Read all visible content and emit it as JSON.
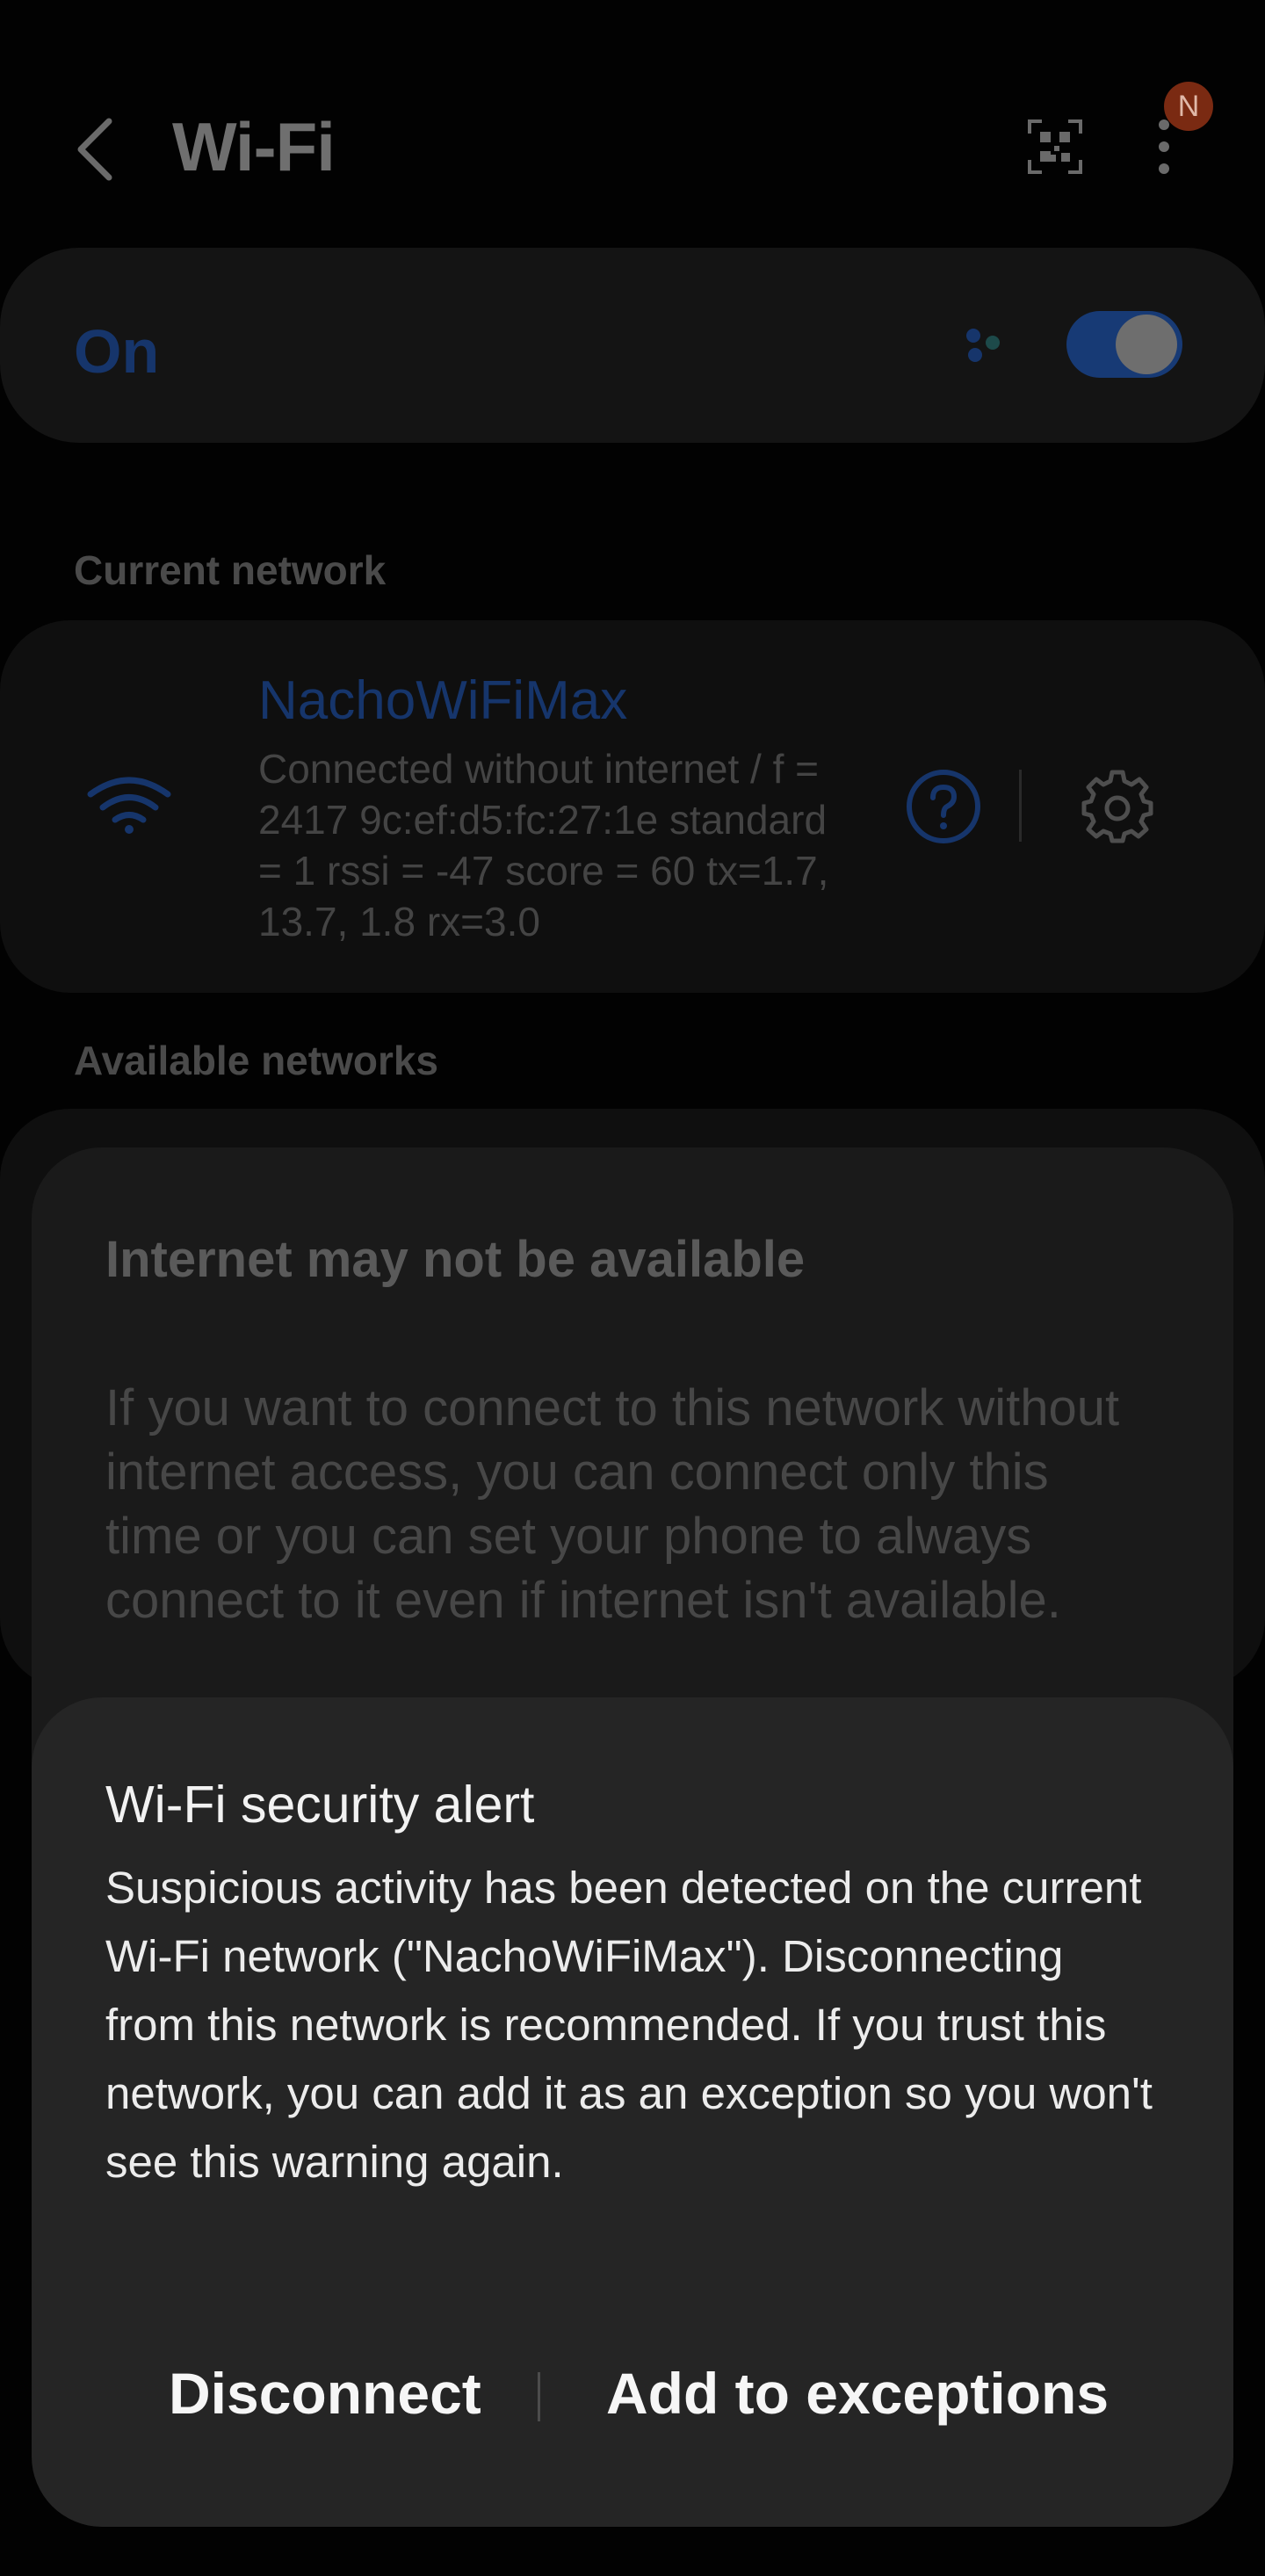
{
  "header": {
    "title": "Wi-Fi",
    "avatar_letter": "N",
    "icons": [
      "back-icon",
      "qr-code-icon",
      "more-options-icon"
    ]
  },
  "wifi_toggle": {
    "label": "On",
    "state": "on"
  },
  "current_network": {
    "section_title": "Current network",
    "name": "NachoWiFiMax",
    "details": "Connected without internet / f = 2417 9c:ef:d5:fc:27:1e standard = 1 rssi = -47 score = 60  tx=1.7, 13.7, 1.8  rx=3.0"
  },
  "available_networks": {
    "section_title": "Available networks"
  },
  "internet_dialog": {
    "title": "Internet may not be available",
    "body": "If you want to connect to this network without internet access, you can connect only this time or you can set your phone to always connect to it even if internet isn't available."
  },
  "security_alert": {
    "title": "Wi-Fi security alert",
    "body": "Suspicious activity has been detected on the current Wi-Fi network (\"NachoWiFiMax\"). Disconnecting from this network is recommended. If you trust this network, you can add it as an exception so you won't see this warning again.",
    "disconnect_label": "Disconnect",
    "exceptions_label": "Add to exceptions"
  },
  "colors": {
    "accent": "#173a75",
    "background": "#020202",
    "alert_bg": "#252525"
  }
}
